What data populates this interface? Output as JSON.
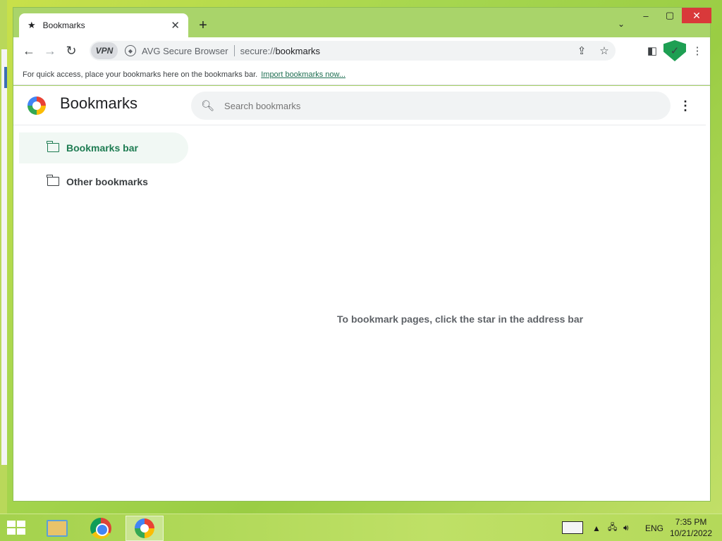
{
  "browser": {
    "tab_title": "Bookmarks",
    "brand_label": "AVG Secure Browser",
    "vpn_label": "VPN",
    "url_scheme": "secure://",
    "url_host": "bookmarks"
  },
  "bookmarks_bar": {
    "hint": "For quick access, place your bookmarks here on the bookmarks bar.",
    "import_link": "Import bookmarks now..."
  },
  "page": {
    "title": "Bookmarks",
    "search_placeholder": "Search bookmarks",
    "sidebar": [
      {
        "label": "Bookmarks bar",
        "selected": true
      },
      {
        "label": "Other bookmarks",
        "selected": false
      }
    ],
    "empty_message": "To bookmark pages, click the star in the address bar"
  },
  "taskbar": {
    "language": "ENG",
    "time": "7:35 PM",
    "date": "10/21/2022"
  }
}
